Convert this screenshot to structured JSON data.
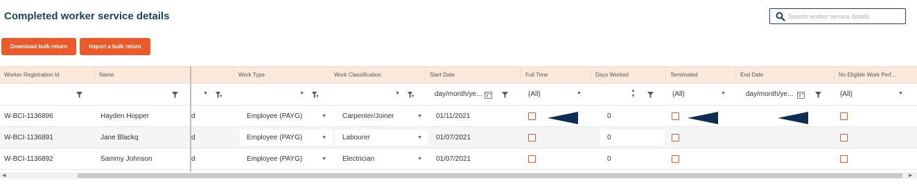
{
  "page": {
    "title": "Completed worker service details",
    "search_placeholder": "Search worker service details"
  },
  "buttons": {
    "download": "Download bulk return",
    "import": "Import a bulk return"
  },
  "columns": {
    "worker_registration_id": "Worker Registration Id",
    "name": "Name",
    "work_type": "Work Type",
    "work_classification": "Work Classification",
    "start_date": "Start Date",
    "full_time": "Full Time",
    "days_worked": "Days Worked",
    "terminated": "Terminated",
    "end_date": "End Date",
    "no_eligible_work": "No Eligible Work Perf..."
  },
  "filters": {
    "date_placeholder": "day/month/ye...",
    "all_label": "(All)"
  },
  "rows": [
    {
      "id": "W-BCI-1136896",
      "name": "Hayden Hopper",
      "partial": "d",
      "work_type": "Employee (PAYG)",
      "classification": "Carpenter/Joiner",
      "start_date": "01/11/2021",
      "days_worked": "0"
    },
    {
      "id": "W-BCI-1136891",
      "name": "Jane Blackq",
      "partial": "d",
      "work_type": "Employee (PAYG)",
      "classification": "Labourer",
      "start_date": "01/07/2021",
      "days_worked": "0"
    },
    {
      "id": "W-BCI-1136892",
      "name": "Sammy Johnson",
      "partial": "d",
      "work_type": "Employee (PAYG)",
      "classification": "Electrician",
      "start_date": "01/07/2021",
      "days_worked": "0"
    }
  ],
  "colors": {
    "accent": "#ec5a2c",
    "title": "#1c3f5a",
    "header_bg": "#fbe9dc",
    "annotation_arrow": "#0d2d52"
  }
}
